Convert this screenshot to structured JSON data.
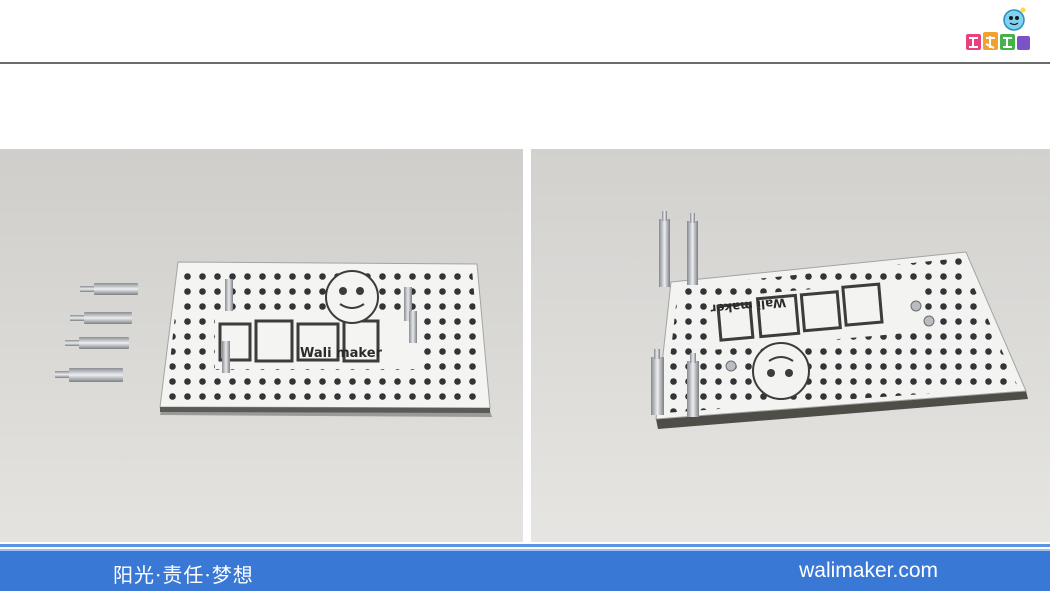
{
  "footer": {
    "slogan": "阳光·责任·梦想",
    "website": "walimaker.com"
  },
  "logo": {
    "icon": "wali-maker-mascot-logo-icon"
  },
  "photos": [
    {
      "name": "left-product-photo",
      "board_text": "Wali maker"
    },
    {
      "name": "right-product-photo",
      "board_text": "Wali maker"
    }
  ],
  "colors": {
    "accent_blue": "#3a78d6",
    "rule_gray": "#6b6b6b",
    "photo_background": "#d8d7d3"
  }
}
